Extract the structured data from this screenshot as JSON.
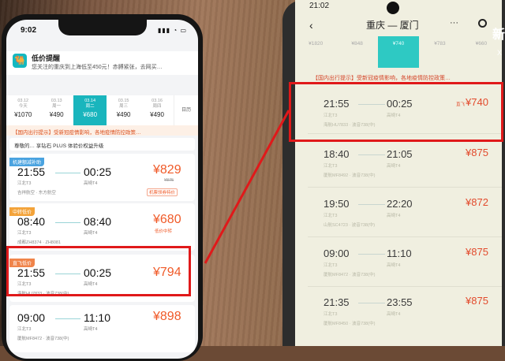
{
  "left_phone": {
    "status_time": "9:02",
    "status_icons": "▮▮▮ ◔ ▭",
    "promo": {
      "title": "低价提醒",
      "text": "您关注的重庆到上海低至450元！赤膊紧张，去网买…"
    },
    "dates": [
      {
        "date": "03.12",
        "day": "今天",
        "price": "¥1070"
      },
      {
        "date": "03.13",
        "day": "周一",
        "price": "¥490"
      },
      {
        "date": "03.14",
        "day": "周二",
        "price": "¥680",
        "selected": true
      },
      {
        "date": "03.15",
        "day": "周三",
        "price": "¥490"
      },
      {
        "date": "03.16",
        "day": "周四",
        "price": "¥490"
      }
    ],
    "calendar_label": "日历",
    "notice": "【国内出行提示】受新冠疫情影响，各地疫情防控政策…",
    "member": "尊敬的… 享钻石 PLUS 体验价权益升级",
    "flights": [
      {
        "tag": "机建额减补助",
        "dep": "21:55",
        "arr": "00:25",
        "dep_ap": "江北T3",
        "arr_ap": "高崎T4",
        "price": "¥829",
        "price_note": "¥875",
        "meta": "吉祥航空 · 东方航空",
        "badge": "机票领券特价"
      },
      {
        "tag": "中转低价",
        "dep": "08:40",
        "arr": "08:40",
        "dep_ap": "江北T3",
        "arr_ap": "高崎T4",
        "price": "¥680",
        "price_note": "低价中转",
        "meta": "成都ZH8374 · ZH8081",
        "badge": "低价中转"
      },
      {
        "tag": "直飞低价",
        "dep": "21:55",
        "arr": "00:25",
        "dep_ap": "江北T3",
        "arr_ap": "高崎T4",
        "price": "¥794",
        "price_note": "",
        "meta": "海航HU7833 · 波音738(中)",
        "badge": ""
      },
      {
        "tag": "",
        "dep": "09:00",
        "arr": "11:10",
        "dep_ap": "江北T3",
        "arr_ap": "高崎T4",
        "price": "¥898",
        "price_note": "",
        "meta": "厦航MF8472 · 波音738(中)",
        "badge": ""
      }
    ]
  },
  "right_phone": {
    "status_time": "21:02",
    "back": "‹",
    "route": "重庆 — 厦门",
    "menu": "···",
    "dates": [
      {
        "price": "¥1820"
      },
      {
        "price": "¥848"
      },
      {
        "price": "¥740",
        "selected": true
      },
      {
        "price": "¥783"
      },
      {
        "price": "¥660"
      }
    ],
    "notice": "【国内出行提示】受新冠疫情影响，各地疫情防控政策…",
    "flights": [
      {
        "dep": "21:55",
        "arr": "00:25",
        "dep_ap": "江北T3",
        "arr_ap": "高崎T4",
        "price": "¥740",
        "meta": "海航HU7833 · 波音738(中)",
        "prefix": "直飞"
      },
      {
        "dep": "18:40",
        "arr": "21:05",
        "dep_ap": "江北T3",
        "arr_ap": "高崎T4",
        "price": "¥875",
        "meta": "厦航MF8492 · 波音738(中)",
        "prefix": ""
      },
      {
        "dep": "19:50",
        "arr": "22:20",
        "dep_ap": "江北T3",
        "arr_ap": "高崎T4",
        "price": "¥872",
        "meta": "山航SC4723 · 波音738(中)",
        "prefix": ""
      },
      {
        "dep": "09:00",
        "arr": "11:10",
        "dep_ap": "江北T3",
        "arr_ap": "高崎T4",
        "price": "¥875",
        "meta": "厦航MF8472 · 波音738(中)",
        "prefix": ""
      },
      {
        "dep": "21:35",
        "arr": "23:55",
        "dep_ap": "江北T3",
        "arr_ap": "高崎T4",
        "price": "¥875",
        "meta": "厦航MF8450 · 波音738(中)",
        "prefix": ""
      }
    ]
  },
  "watermark": {
    "line1": "新",
    "line2": "X"
  },
  "colors": {
    "accent": "#19b5bd",
    "price": "#f05a28",
    "highlight": "#e0191a"
  }
}
